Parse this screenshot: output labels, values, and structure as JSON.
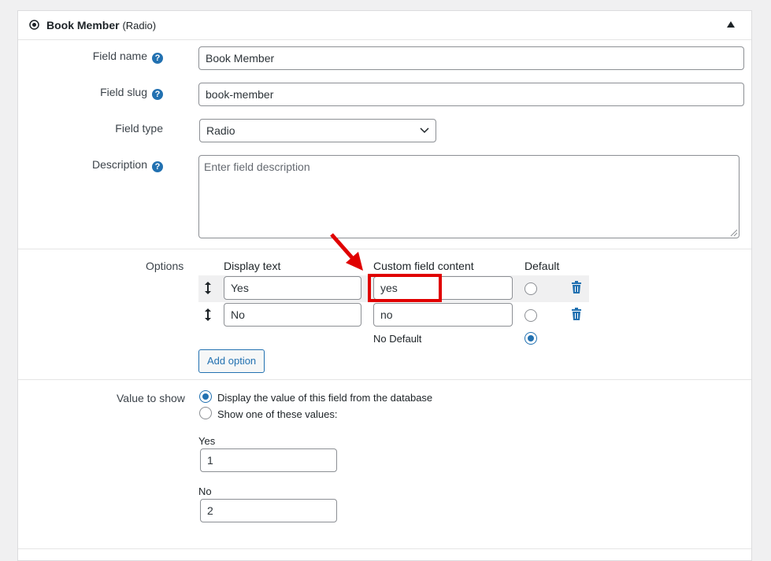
{
  "header": {
    "title": "Book Member",
    "subtitle": "(Radio)"
  },
  "field_name": {
    "label": "Field name",
    "value": "Book Member"
  },
  "field_slug": {
    "label": "Field slug",
    "value": "book-member"
  },
  "field_type": {
    "label": "Field type",
    "selected": "Radio"
  },
  "description": {
    "label": "Description",
    "placeholder": "Enter field description",
    "value": ""
  },
  "help_glyph": "?",
  "options": {
    "label": "Options",
    "columns": {
      "display_text": "Display text",
      "custom_content": "Custom field content",
      "default": "Default"
    },
    "rows": [
      {
        "display_text": "Yes",
        "custom_content": "yes",
        "default": false
      },
      {
        "display_text": "No",
        "custom_content": "no",
        "default": false
      }
    ],
    "no_default_label": "No Default",
    "no_default_selected": true,
    "add_button": "Add option"
  },
  "value_to_show": {
    "label": "Value to show",
    "choices": [
      {
        "label": "Display the value of this field from the database",
        "selected": true
      },
      {
        "label": "Show one of these values:",
        "selected": false
      }
    ],
    "values": [
      {
        "label": "Yes",
        "value": "1"
      },
      {
        "label": "No",
        "value": "2"
      }
    ]
  },
  "colors": {
    "accent": "#2271b1",
    "annotation": "#e00000"
  },
  "icons": {
    "header": "radio-dot-icon",
    "toggle": "triangle-up-icon",
    "drag": "drag-handle-icon",
    "delete": "trash-icon"
  }
}
